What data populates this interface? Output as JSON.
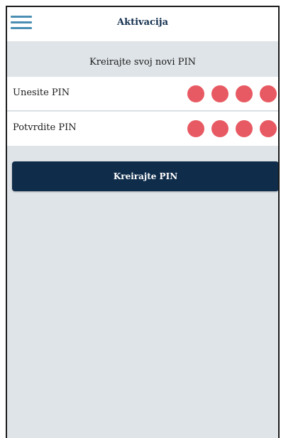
{
  "header": {
    "title": "Aktivacija",
    "menu_icon": "hamburger-menu-icon"
  },
  "subtitle": "Kreirajte svoj novi PIN",
  "pin_fields": [
    {
      "label": "Unesite PIN",
      "filled": 4,
      "length": 4
    },
    {
      "label": "Potvrdite PIN",
      "filled": 4,
      "length": 4
    }
  ],
  "create_button": {
    "label": "Kreirajte PIN"
  },
  "colors": {
    "accent": "#0f2c4a",
    "pin_dot": "#e85a63",
    "menu_icon": "#4a8fb3",
    "background": "#dfe4e8"
  }
}
